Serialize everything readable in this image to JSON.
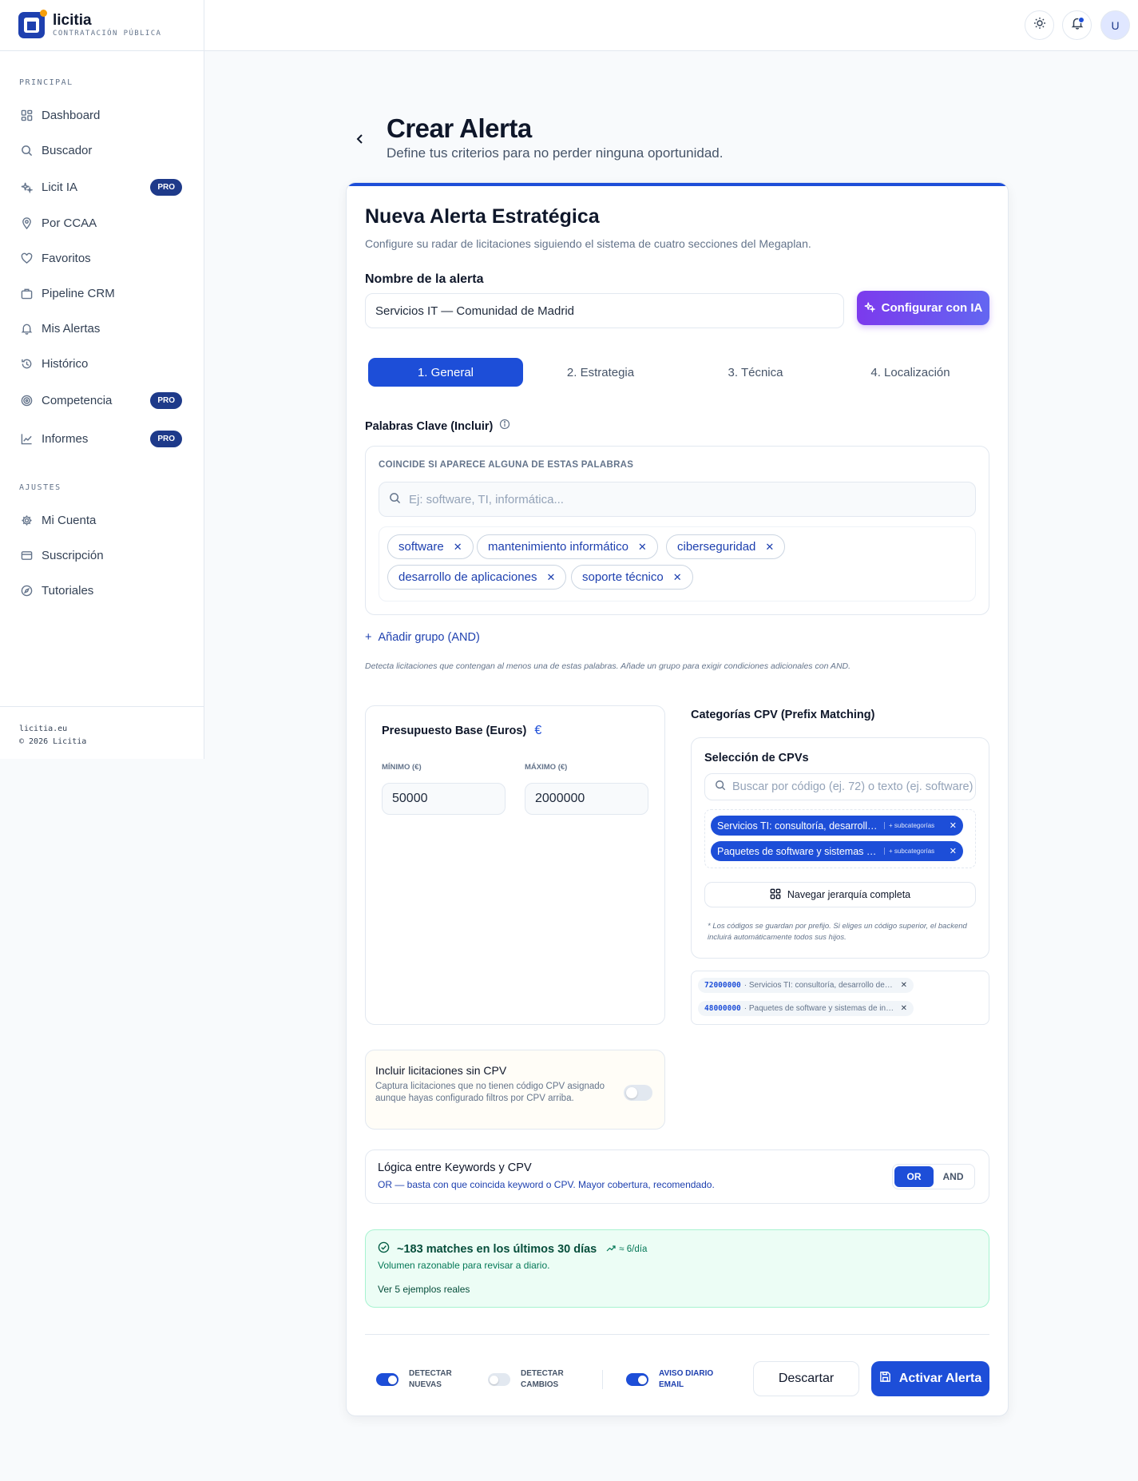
{
  "brand": {
    "name": "licitia",
    "subtitle": "CONTRATACIÓN PÚBLICA"
  },
  "sidebar": {
    "section_main": "PRINCIPAL",
    "items": [
      {
        "label": "Dashboard",
        "icon": "dashboard-icon"
      },
      {
        "label": "Buscador",
        "icon": "search-icon"
      },
      {
        "label": "Licit IA",
        "icon": "sparkles-icon",
        "badge": "PRO"
      },
      {
        "label": "Por CCAA",
        "icon": "map-pin-icon"
      },
      {
        "label": "Favoritos",
        "icon": "heart-icon"
      },
      {
        "label": "Pipeline CRM",
        "icon": "briefcase-icon"
      },
      {
        "label": "Mis Alertas",
        "icon": "bell-icon"
      },
      {
        "label": "Histórico",
        "icon": "history-icon"
      },
      {
        "label": "Competencia",
        "icon": "target-icon",
        "badge": "PRO"
      },
      {
        "label": "Informes",
        "icon": "chart-icon",
        "badge": "PRO"
      }
    ],
    "section_settings": "AJUSTES",
    "settings_items": [
      {
        "label": "Mi Cuenta",
        "icon": "gear-icon"
      },
      {
        "label": "Suscripción",
        "icon": "credit-card-icon"
      },
      {
        "label": "Tutoriales",
        "icon": "compass-icon"
      }
    ],
    "footer_domain": "licitia.eu",
    "footer_copyright": "© 2026 Licitia"
  },
  "topbar": {
    "avatar_letter": "U"
  },
  "header": {
    "title": "Crear Alerta",
    "subtitle": "Define tus criterios para no perder ninguna oportunidad."
  },
  "form": {
    "title": "Nueva Alerta Estratégica",
    "subtitle": "Configure su radar de licitaciones siguiendo el sistema de cuatro secciones del Megaplan.",
    "name_label": "Nombre de la alerta",
    "name_value": "Servicios IT — Comunidad de Madrid",
    "ai_button": "Configurar con IA",
    "tabs": [
      "1. General",
      "2. Estrategia",
      "3. Técnica",
      "4. Localización"
    ],
    "keywords_label": "Palabras Clave (Incluir)",
    "keywords_caption": "COINCIDE SI APARECE ALGUNA DE ESTAS PALABRAS",
    "keywords_placeholder": "Ej: software, TI, informática...",
    "keywords": [
      "software",
      "mantenimiento informático",
      "ciberseguridad",
      "desarrollo de aplicaciones",
      "soporte técnico"
    ],
    "add_group": "Añadir grupo (AND)",
    "keywords_help": "Detecta licitaciones que contengan al menos una de estas palabras. Añade un grupo para exigir condiciones adicionales con AND.",
    "budget_title": "Presupuesto Base (Euros)",
    "budget_symbol": "€",
    "min_label": "MÍNIMO (€)",
    "min_value": "50000",
    "max_label": "MÁXIMO (€)",
    "max_value": "2000000",
    "cpv_title": "Categorías CPV (Prefix Matching)",
    "cpv_panel_title": "Selección de CPVs",
    "cpv_placeholder": "Buscar por código (ej. 72) o texto (ej. software)",
    "cpv_chips": [
      {
        "label": "Servicios TI: consultoría, desarrollo de software, Internet y apoyo",
        "sub": "+ subcategorías"
      },
      {
        "label": "Paquetes de software y sistemas de información",
        "sub": "+ subcategorías"
      }
    ],
    "cpv_browse": "Navegar jerarquía completa",
    "cpv_note": "* Los códigos se guardan por prefijo. Si eliges un código superior, el backend incluirá automáticamente todos sus hijos.",
    "cpv_selected": [
      {
        "code": "72000000",
        "label": "· Servicios TI: consultoría, desarrollo de software"
      },
      {
        "code": "48000000",
        "label": "· Paquetes de software y sistemas de información"
      }
    ],
    "nocpv_title": "Incluir licitaciones sin CPV",
    "nocpv_desc": "Captura licitaciones que no tienen código CPV asignado aunque hayas configurado filtros por CPV arriba.",
    "logic_title": "Lógica entre Keywords y CPV",
    "logic_desc": "OR — basta con que coincida keyword o CPV. Mayor cobertura, recomendado.",
    "logic_options": [
      "OR",
      "AND"
    ],
    "matches_title": "~183 matches en los últimos 30 días",
    "matches_rate": "≈ 6/día",
    "matches_desc": "Volumen razonable para revisar a diario.",
    "matches_link": "Ver 5 ejemplos reales",
    "toggle_new": "DETECTAR NUEVAS",
    "toggle_changes": "DETECTAR CAMBIOS",
    "toggle_email": "AVISO DIARIO EMAIL",
    "discard": "Descartar",
    "activate": "Activar Alerta"
  },
  "colors": {
    "primary": "#1d4ed8",
    "ai_gradient_start": "#7c3aed",
    "success_bg": "#ecfdf5"
  }
}
